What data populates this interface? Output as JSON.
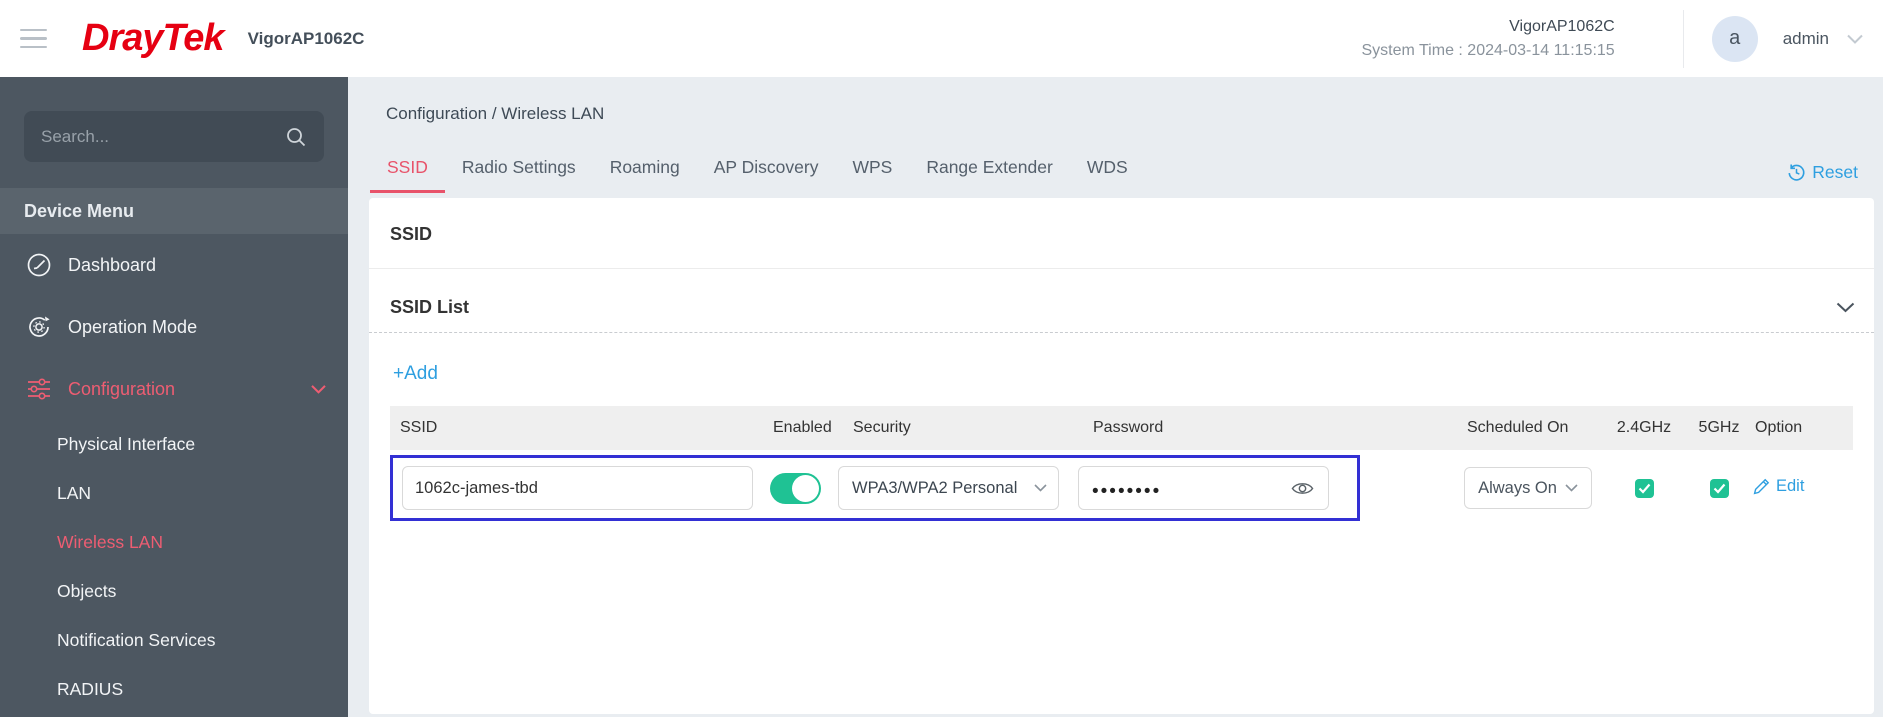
{
  "header": {
    "brand_dray": "Dray",
    "brand_tek": "Tek",
    "model": "VigorAP1062C",
    "device_name": "VigorAP1062C",
    "system_time": "System Time : 2024-03-14 11:15:15",
    "avatar_letter": "a",
    "username": "admin"
  },
  "sidebar": {
    "search_placeholder": "Search...",
    "section_title": "Device Menu",
    "items": [
      {
        "label": "Dashboard",
        "icon": "gauge-icon",
        "active": false
      },
      {
        "label": "Operation Mode",
        "icon": "operation-mode-icon",
        "active": false
      },
      {
        "label": "Configuration",
        "icon": "sliders-icon",
        "active": true,
        "expanded": true
      }
    ],
    "sub_items": [
      {
        "label": "Physical Interface",
        "active": false
      },
      {
        "label": "LAN",
        "active": false
      },
      {
        "label": "Wireless LAN",
        "active": true
      },
      {
        "label": "Objects",
        "active": false
      },
      {
        "label": "Notification Services",
        "active": false
      },
      {
        "label": "RADIUS",
        "active": false
      }
    ]
  },
  "main": {
    "breadcrumb": "Configuration / Wireless LAN",
    "tabs": [
      "SSID",
      "Radio Settings",
      "Roaming",
      "AP Discovery",
      "WPS",
      "Range Extender",
      "WDS"
    ],
    "active_tab": "SSID",
    "reset_label": "Reset",
    "section_title": "SSID",
    "list_title": "SSID List",
    "add_label": "+Add",
    "table": {
      "headers": [
        "SSID",
        "Enabled",
        "Security",
        "Password",
        "Scheduled On",
        "2.4GHz",
        "5GHz",
        "Option"
      ],
      "row": {
        "ssid": "1062c-james-tbd",
        "enabled": true,
        "security": "WPA3/WPA2 Personal",
        "password_masked": "••••••••",
        "scheduled_on": "Always On",
        "band_24ghz": true,
        "band_5ghz": true,
        "option_label": "Edit"
      }
    }
  },
  "colors": {
    "brand_red": "#e60012",
    "accent_red": "#e8536a",
    "link_blue": "#2e9fe0",
    "toggle_green": "#1fc294",
    "row_highlight_border": "#3330d4",
    "sidebar_bg": "#4d5761",
    "page_bg": "#e9edf1"
  }
}
